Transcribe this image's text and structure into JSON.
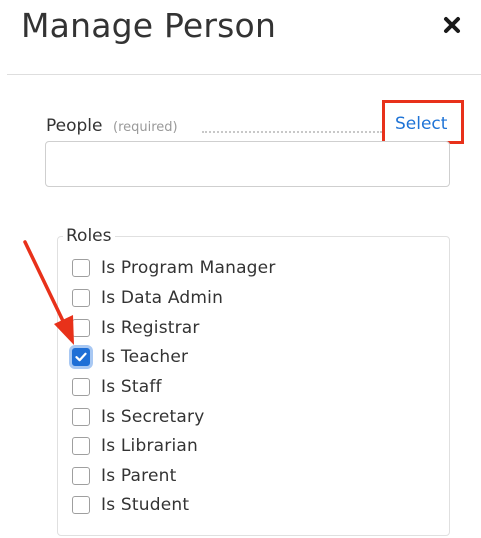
{
  "dialog": {
    "title": "Manage Person",
    "close_icon": "close-icon"
  },
  "people": {
    "label": "People",
    "required_note": "(required)",
    "select_label": "Select",
    "input_value": ""
  },
  "roles": {
    "legend": "Roles",
    "items": [
      {
        "label": "Is Program Manager",
        "checked": false
      },
      {
        "label": "Is Data Admin",
        "checked": false
      },
      {
        "label": "Is Registrar",
        "checked": false
      },
      {
        "label": "Is Teacher",
        "checked": true
      },
      {
        "label": "Is Staff",
        "checked": false
      },
      {
        "label": "Is Secretary",
        "checked": false
      },
      {
        "label": "Is Librarian",
        "checked": false
      },
      {
        "label": "Is Parent",
        "checked": false
      },
      {
        "label": "Is Student",
        "checked": false
      }
    ]
  },
  "colors": {
    "annotation_red": "#e8311a",
    "link_blue": "#1e73d6",
    "checkbox_blue": "#1f6fd6"
  }
}
